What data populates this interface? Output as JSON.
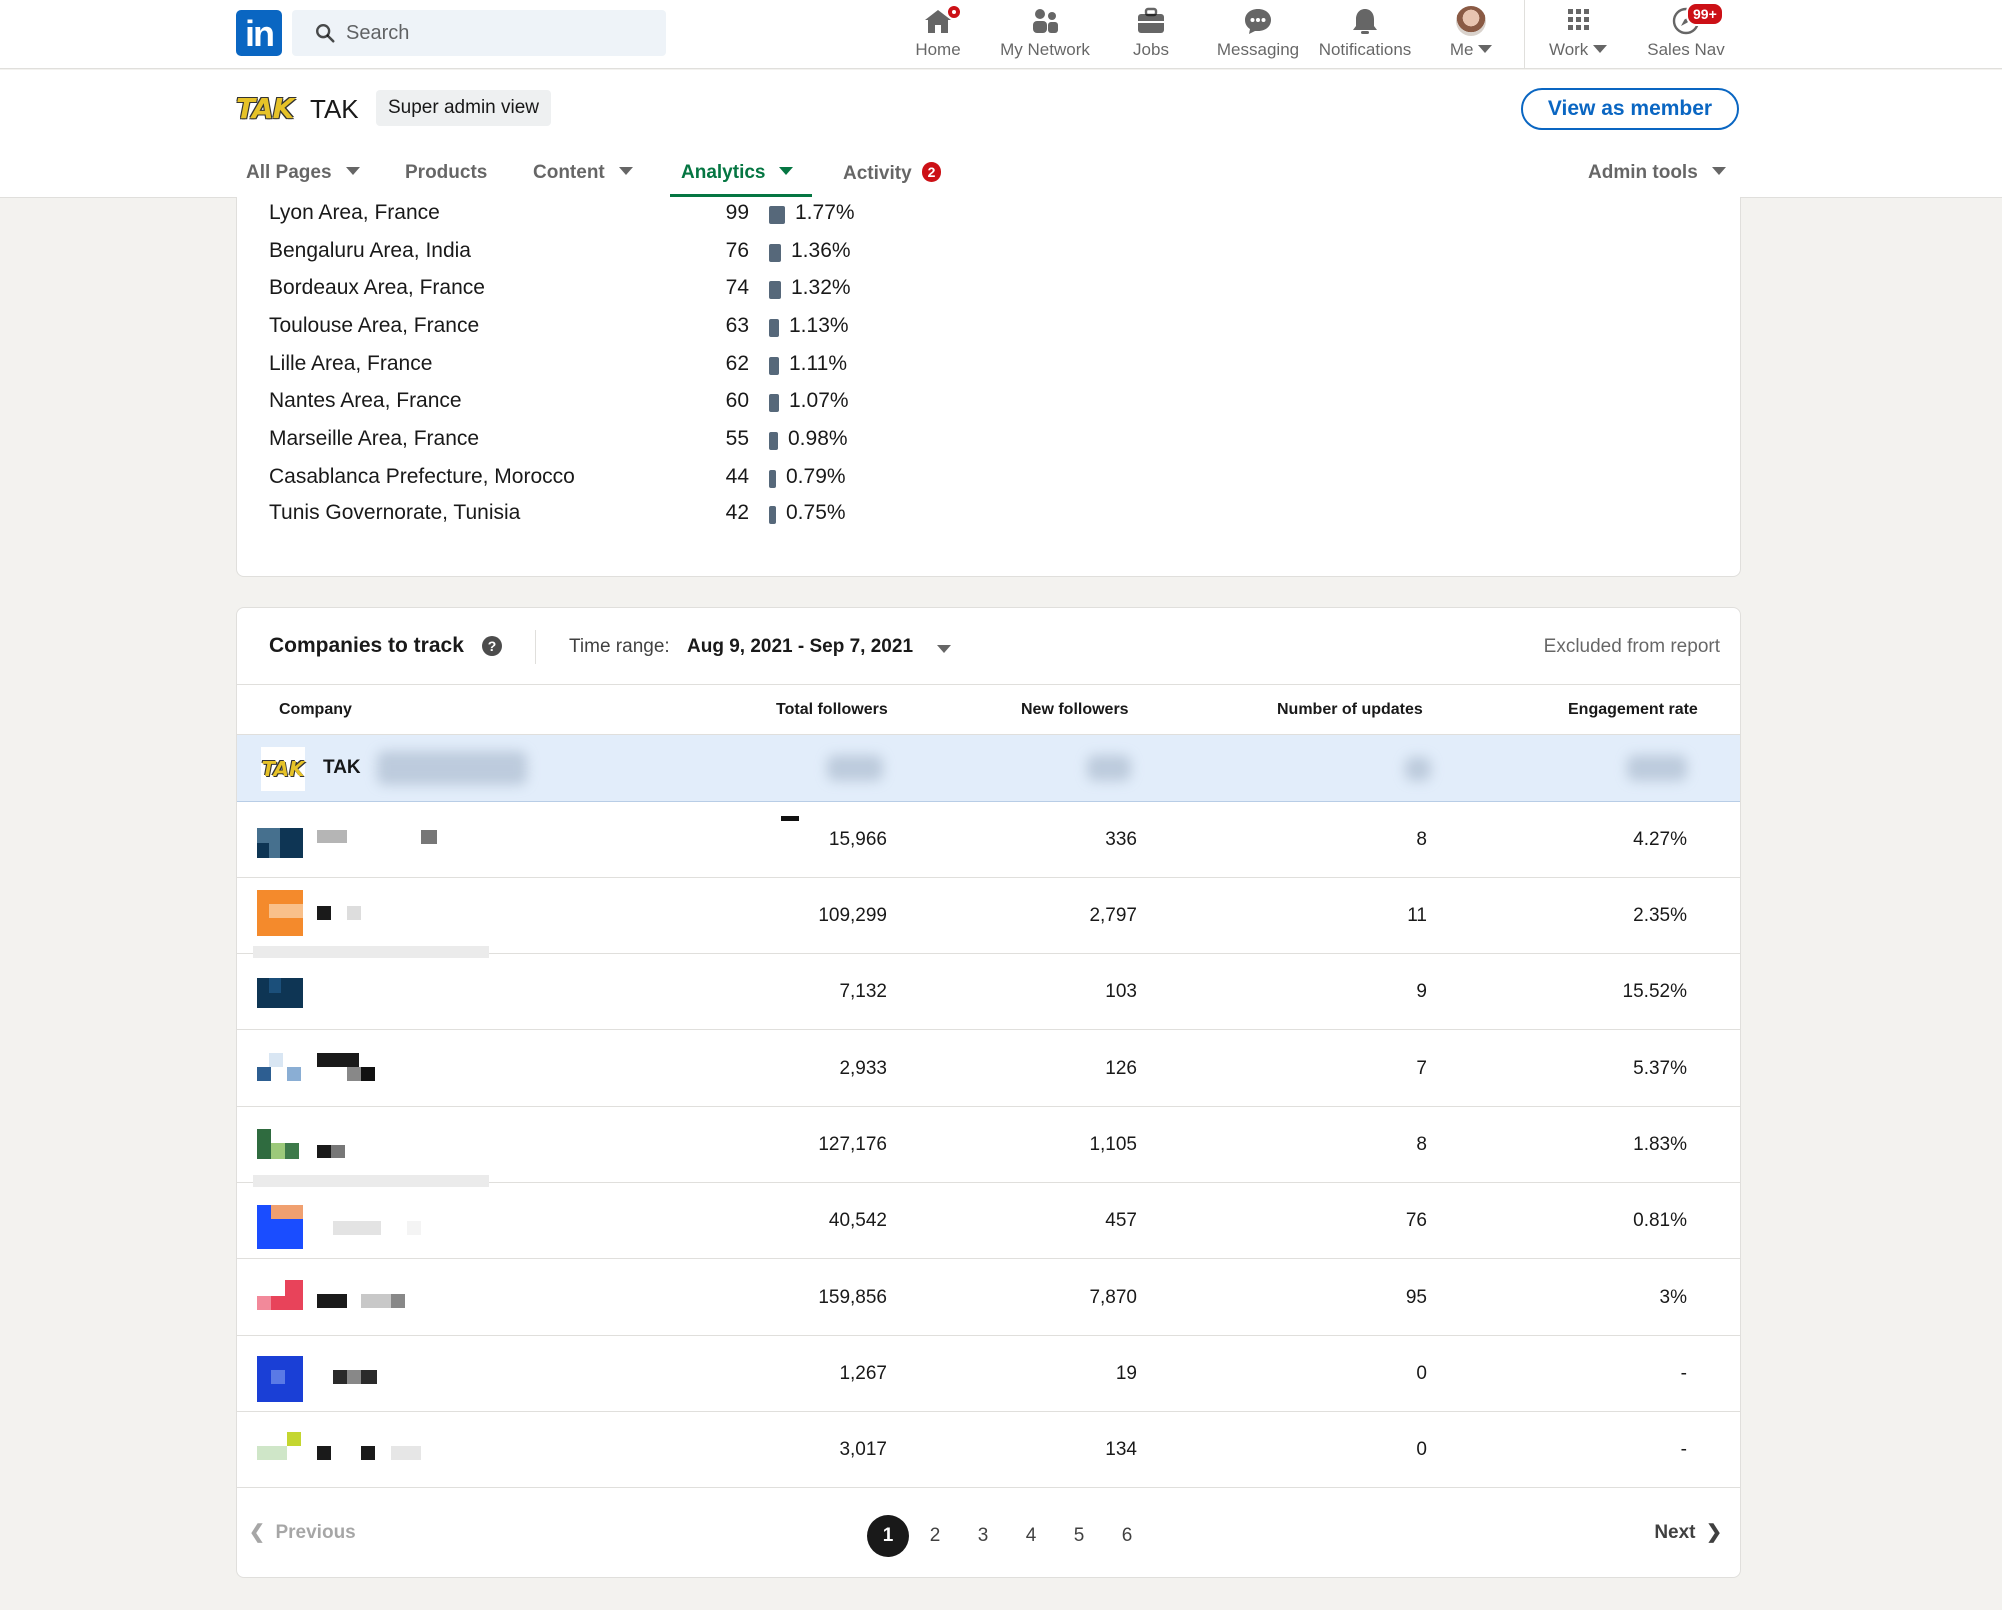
{
  "nav": {
    "logo": "in",
    "search_placeholder": "Search",
    "items": [
      {
        "label": "Home",
        "icon": "home-icon"
      },
      {
        "label": "My Network",
        "icon": "network-icon"
      },
      {
        "label": "Jobs",
        "icon": "briefcase-icon"
      },
      {
        "label": "Messaging",
        "icon": "messaging-icon"
      },
      {
        "label": "Notifications",
        "icon": "bell-icon"
      },
      {
        "label": "Me",
        "icon": "avatar"
      },
      {
        "label": "Work",
        "icon": "grid-icon"
      },
      {
        "label": "Sales Nav",
        "icon": "compass-icon"
      }
    ],
    "sales_nav_badge": "99+"
  },
  "header": {
    "org_logo_text": "TAK",
    "org_name": "TAK",
    "admin_view": "Super admin view",
    "view_as_member": "View as member",
    "tabs": [
      {
        "label": "All Pages"
      },
      {
        "label": "Products"
      },
      {
        "label": "Content"
      },
      {
        "label": "Analytics"
      },
      {
        "label": "Activity",
        "badge": "2"
      },
      {
        "label": "Admin tools"
      }
    ]
  },
  "locations": [
    {
      "name": "Lyon Area, France",
      "count": "99",
      "pct": "1.77%",
      "share": 1.77
    },
    {
      "name": "Bengaluru Area, India",
      "count": "76",
      "pct": "1.36%",
      "share": 1.36
    },
    {
      "name": "Bordeaux Area, France",
      "count": "74",
      "pct": "1.32%",
      "share": 1.32
    },
    {
      "name": "Toulouse Area, France",
      "count": "63",
      "pct": "1.13%",
      "share": 1.13
    },
    {
      "name": "Lille Area, France",
      "count": "62",
      "pct": "1.11%",
      "share": 1.11
    },
    {
      "name": "Nantes Area, France",
      "count": "60",
      "pct": "1.07%",
      "share": 1.07
    },
    {
      "name": "Marseille Area, France",
      "count": "55",
      "pct": "0.98%",
      "share": 0.98
    },
    {
      "name": "Casablanca Prefecture, Morocco",
      "count": "44",
      "pct": "0.79%",
      "share": 0.79
    },
    {
      "name": "Tunis Governorate, Tunisia",
      "count": "42",
      "pct": "0.75%",
      "share": 0.75
    }
  ],
  "companies": {
    "title": "Companies to track",
    "help_icon": "?",
    "time_range_label": "Time range:",
    "time_range_value": "Aug 9, 2021 - Sep 7, 2021",
    "excluded_label": "Excluded from report",
    "columns": [
      "Company",
      "Total followers",
      "New followers",
      "Number of updates",
      "Engagement rate"
    ],
    "own_company": {
      "logo_text": "TAK",
      "name": "TAK"
    },
    "rows": [
      {
        "total": "15,966",
        "new": "336",
        "updates": "8",
        "engagement": "4.27%"
      },
      {
        "total": "109,299",
        "new": "2,797",
        "updates": "11",
        "engagement": "2.35%"
      },
      {
        "total": "7,132",
        "new": "103",
        "updates": "9",
        "engagement": "15.52%"
      },
      {
        "total": "2,933",
        "new": "126",
        "updates": "7",
        "engagement": "5.37%"
      },
      {
        "total": "127,176",
        "new": "1,105",
        "updates": "8",
        "engagement": "1.83%"
      },
      {
        "total": "40,542",
        "new": "457",
        "updates": "76",
        "engagement": "0.81%"
      },
      {
        "total": "159,856",
        "new": "7,870",
        "updates": "95",
        "engagement": "3%"
      },
      {
        "total": "1,267",
        "new": "19",
        "updates": "0",
        "engagement": "-"
      },
      {
        "total": "3,017",
        "new": "134",
        "updates": "0",
        "engagement": "-"
      }
    ],
    "pagination": {
      "prev": "Previous",
      "next": "Next",
      "pages": [
        "1",
        "2",
        "3",
        "4",
        "5",
        "6"
      ],
      "current": "1"
    }
  },
  "colors": {
    "linkedin_blue": "#0a66c2",
    "analytics_green": "#057642",
    "badge_red": "#cc1016",
    "bar_slate": "#56687a",
    "highlight_row": "#e2edfa"
  }
}
